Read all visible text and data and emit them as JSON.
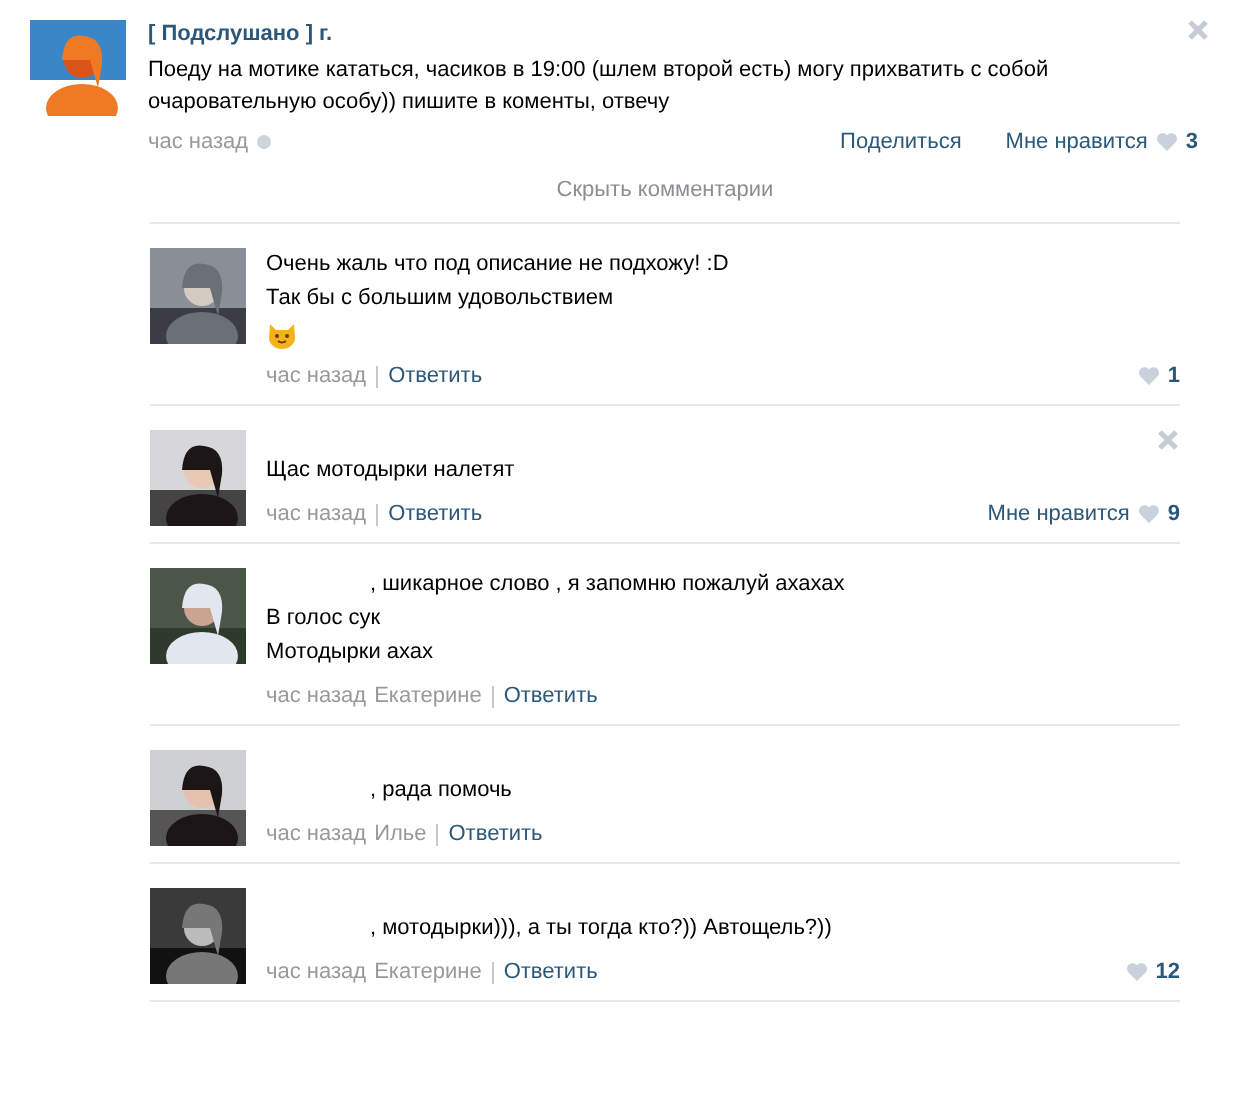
{
  "post": {
    "author": "[ Подслушано ] г.",
    "text": "Поеду на мотике кататься, часиков в 19:00 (шлем второй есть) могу прихватить с собой очаровательную особу)) пишите в коменты, отвечу",
    "time": "час назад",
    "share": "Поделиться",
    "like_label": "Мне нравится",
    "like_count": "3",
    "closable": true
  },
  "toggle_comments": "Скрыть комментарии",
  "comments": [
    {
      "lines": [
        {
          "kind": "text",
          "text": "Очень жаль что под описание не подхожу! :D",
          "redacted": false
        },
        {
          "kind": "text",
          "text": "Так бы с большим удовольствием",
          "redacted": false
        },
        {
          "kind": "emoji"
        }
      ],
      "time": "час назад",
      "reply": "Ответить",
      "like_count": "1",
      "closable": false
    },
    {
      "lines": [
        {
          "kind": "text",
          "text": "Щас мотодырки налетят",
          "redacted": false
        }
      ],
      "time": "час назад",
      "reply": "Ответить",
      "like_label": "Мне нравится",
      "like_count": "9",
      "closable": true
    },
    {
      "lines": [
        {
          "kind": "text",
          "text": ", шикарное слово , я запомню пожалуй ахахах",
          "redacted": true
        },
        {
          "kind": "text",
          "text": "В голос сук",
          "redacted": false
        },
        {
          "kind": "text",
          "text": "Мотодырки ахах",
          "redacted": false
        }
      ],
      "time": "час назад",
      "addressee": "Екатерине",
      "reply": "Ответить",
      "closable": false
    },
    {
      "lines": [
        {
          "kind": "text",
          "text": ", рада помочь",
          "redacted": true
        }
      ],
      "time": "час назад",
      "addressee": "Илье",
      "reply": "Ответить",
      "closable": false
    },
    {
      "lines": [
        {
          "kind": "text",
          "text": ", мотодырки))), а ты тогда кто?)) Автощель?))",
          "redacted": true
        }
      ],
      "time": "час назад",
      "addressee": "Екатерине",
      "reply": "Ответить",
      "like_count": "12",
      "closable": false
    }
  ]
}
